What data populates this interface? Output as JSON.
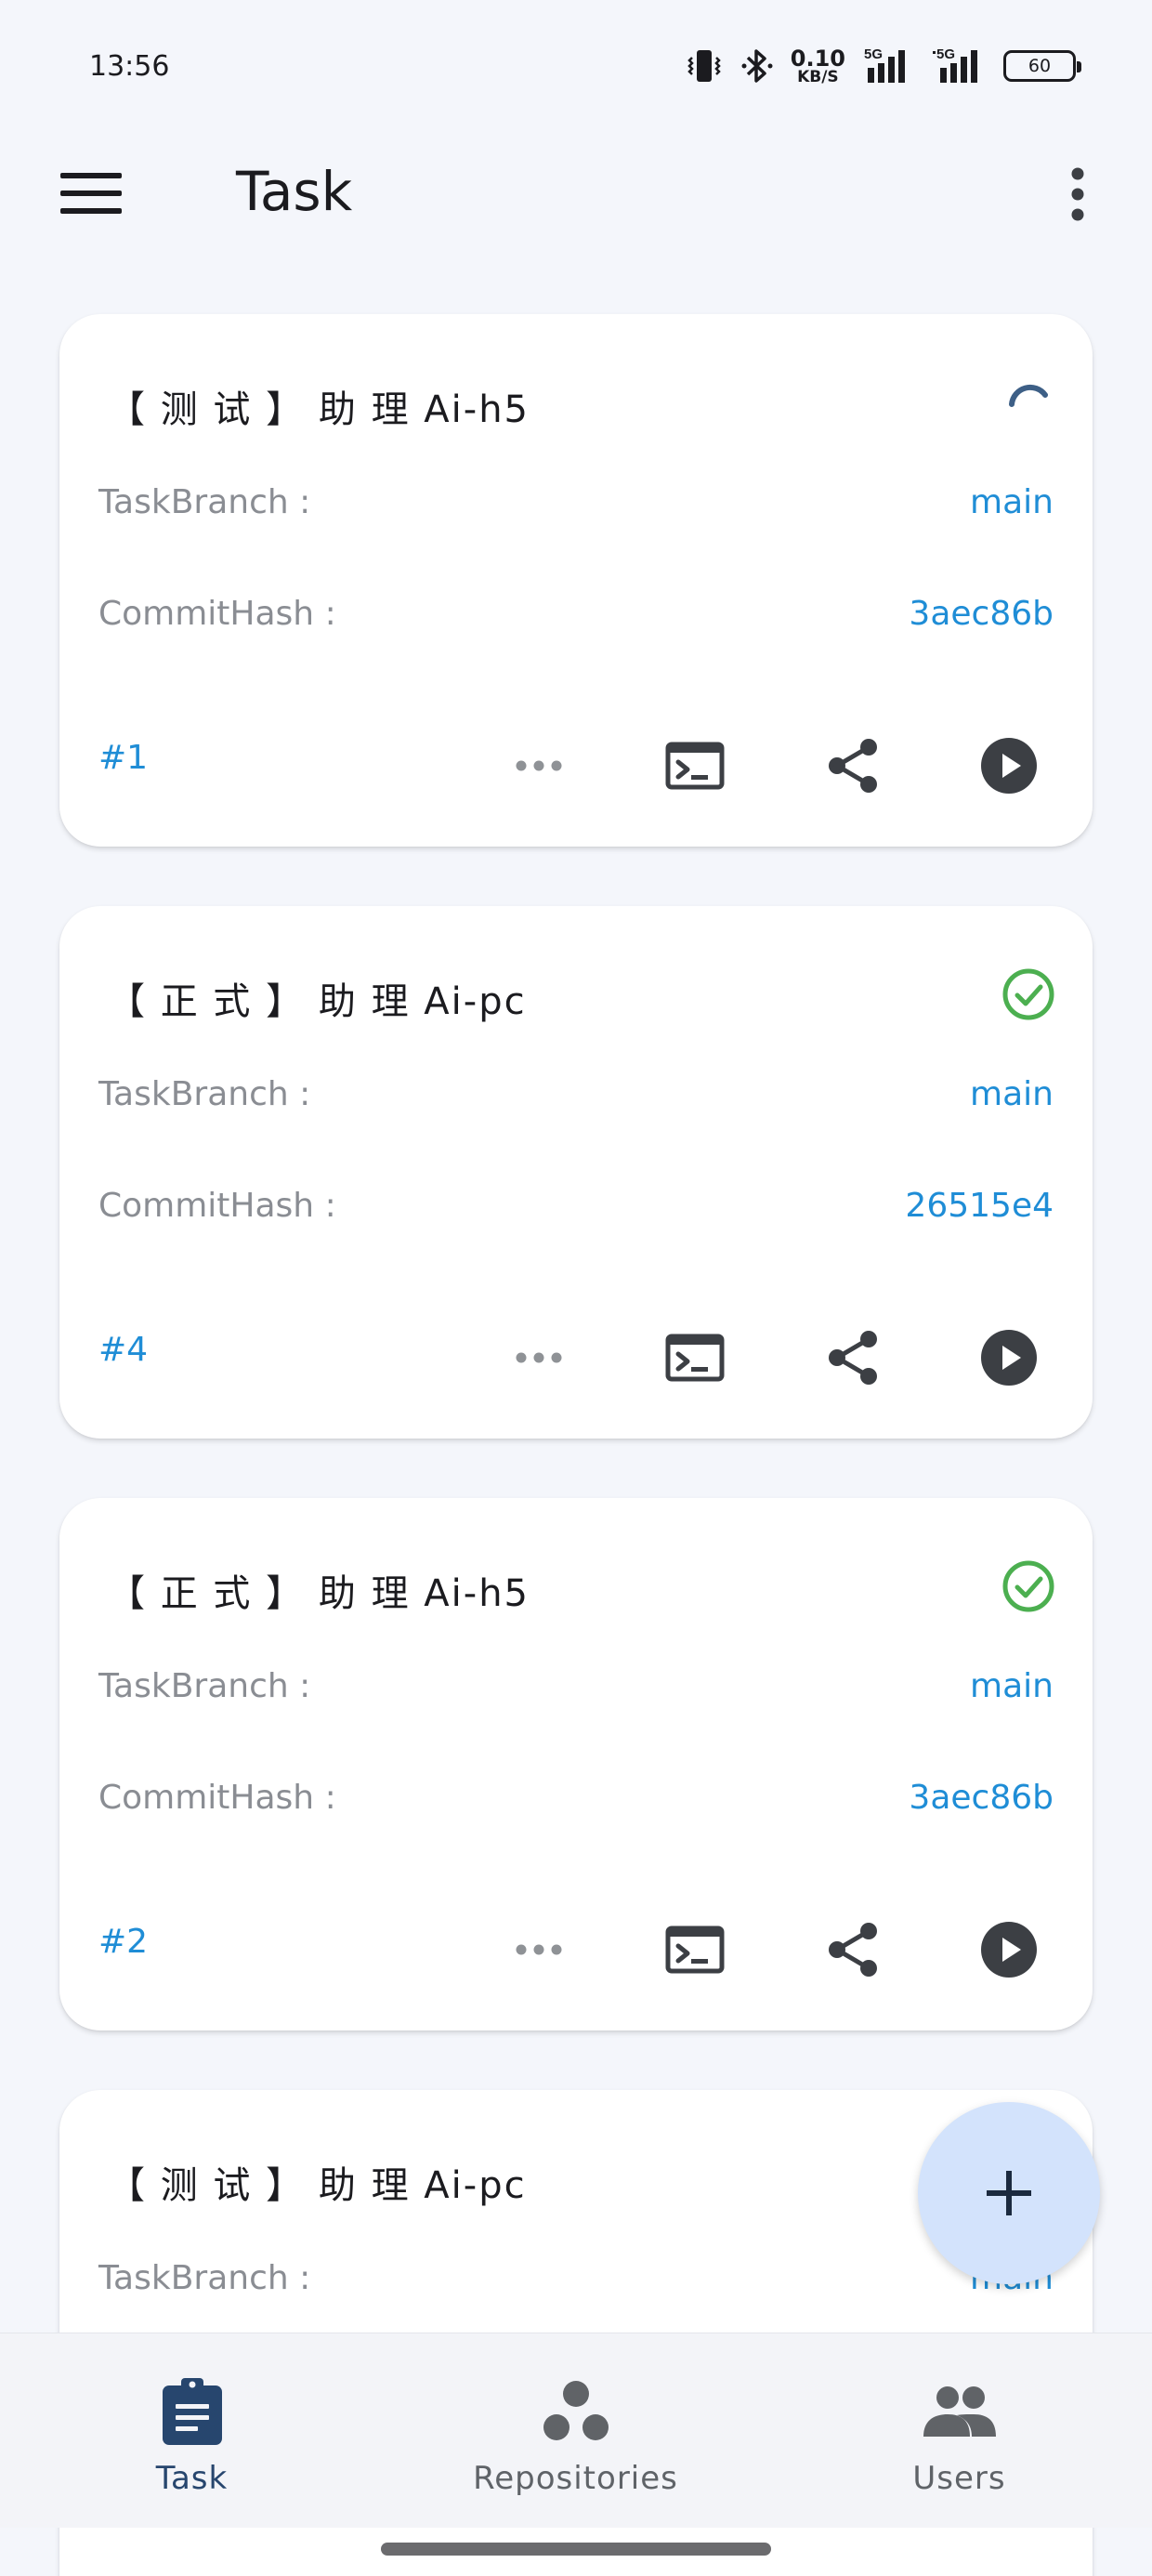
{
  "status_bar": {
    "time": "13:56",
    "net_speed_value": "0.10",
    "net_speed_unit": "KB/S",
    "network_1": "5G",
    "network_2": "5G",
    "battery": "60",
    "icons": [
      "vibrate-icon",
      "bluetooth-icon",
      "signal-icon",
      "signal-icon",
      "battery-icon"
    ]
  },
  "app_bar": {
    "title": "Task",
    "menu_icon": "menu-icon",
    "more_icon": "more-vertical-icon"
  },
  "tasks": [
    {
      "title": "【 测 试 】 助 理 Ai-h5",
      "status": "running",
      "branch_label": "TaskBranch :",
      "branch": "main",
      "hash_label": "CommitHash :",
      "hash": "3aec86b",
      "number": "#1"
    },
    {
      "title": "【 正 式 】 助 理 Ai-pc",
      "status": "success",
      "branch_label": "TaskBranch :",
      "branch": "main",
      "hash_label": "CommitHash :",
      "hash": "26515e4",
      "number": "#4"
    },
    {
      "title": "【 正 式 】 助 理 Ai-h5",
      "status": "success",
      "branch_label": "TaskBranch :",
      "branch": "main",
      "hash_label": "CommitHash :",
      "hash": "3aec86b",
      "number": "#2"
    },
    {
      "title": "【 测 试 】 助 理 Ai-pc",
      "status": "",
      "branch_label": "TaskBranch :",
      "branch": "main"
    }
  ],
  "card_actions": [
    "more-horizontal-icon",
    "terminal-icon",
    "share-icon",
    "play-icon"
  ],
  "fab": {
    "icon": "plus-icon"
  },
  "bottom_nav": [
    {
      "label": "Task",
      "icon": "clipboard-icon",
      "active": true
    },
    {
      "label": "Repositories",
      "icon": "workspaces-icon",
      "active": false
    },
    {
      "label": "Users",
      "icon": "people-icon",
      "active": false
    }
  ],
  "colors": {
    "accent": "#1f8dd6",
    "success": "#4caf50",
    "running": "#3d5f86",
    "nav_active": "#27466e",
    "fab_bg": "#d3e3fc",
    "background": "#f4f6fb"
  }
}
